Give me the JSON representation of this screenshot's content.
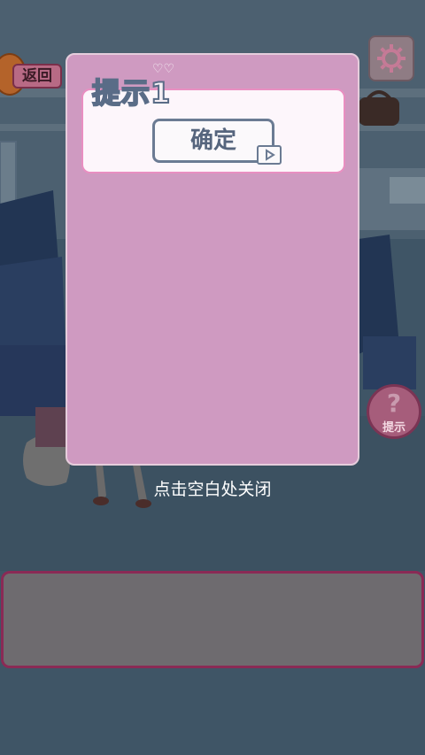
{
  "top_bar": {
    "back_label": "返回"
  },
  "hint_button": {
    "symbol": "?",
    "label": "提示"
  },
  "hint_dialog": {
    "title": "提示1",
    "confirm_label": "确定"
  },
  "close_tip": "点击空白处关闭",
  "colors": {
    "dialog_bg": "#cf9ac1",
    "answer_panel_border": "#8a2a55",
    "overlay_bg": "#3f5566"
  },
  "icons": {
    "settings": "gear-icon",
    "video": "play-video-icon",
    "hearts": "hearts-icon"
  }
}
